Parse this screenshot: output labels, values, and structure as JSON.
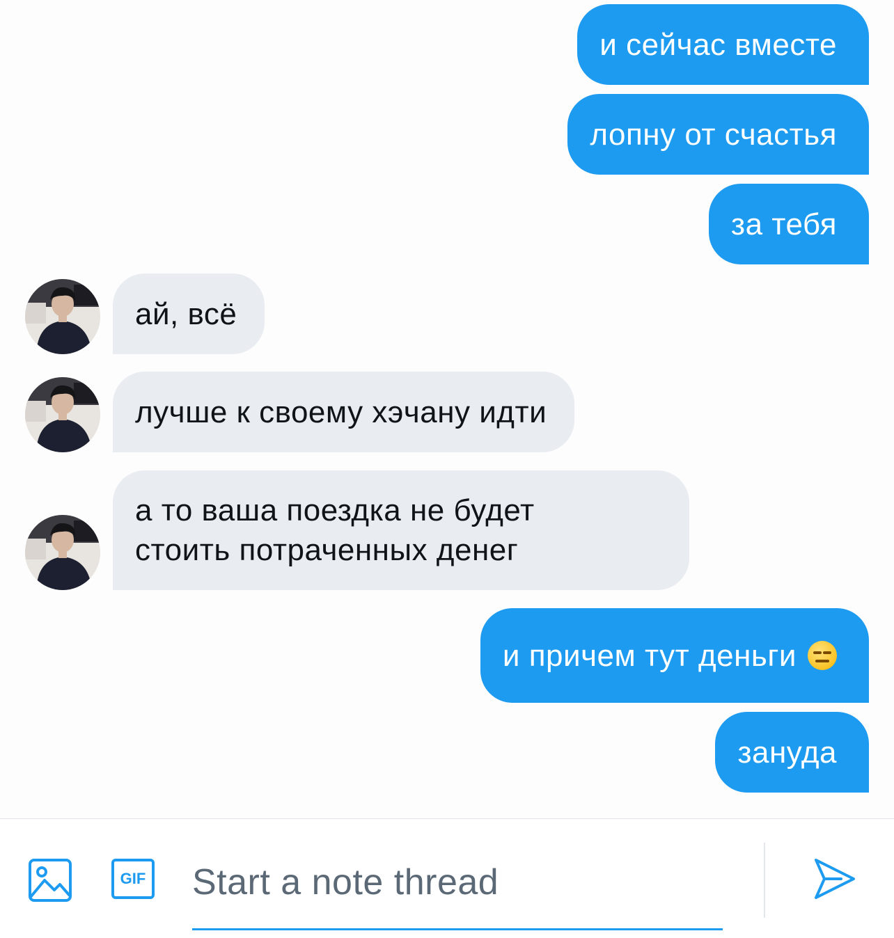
{
  "messages": [
    {
      "side": "out",
      "text": "и сейчас вместе"
    },
    {
      "side": "out",
      "text": "лопну от счастья"
    },
    {
      "side": "out",
      "text": "за тебя"
    },
    {
      "side": "in",
      "text": "ай, всё"
    },
    {
      "side": "in",
      "text": "лучше к своему хэчану идти"
    },
    {
      "side": "in",
      "lines": [
        "а то ваша поездка не будет",
        "стоить потраченных денег"
      ]
    },
    {
      "side": "out",
      "text": "и причем тут деньги",
      "emoji": "expressionless-face-emoji"
    },
    {
      "side": "out",
      "text": "зануда"
    }
  ],
  "composer": {
    "placeholder": "Start a note thread",
    "gif_label": "GIF",
    "image_icon": "image-icon",
    "send_icon": "send-icon"
  },
  "colors": {
    "accent": "#1d9bf0",
    "incoming_bubble": "#e9ecf1",
    "placeholder": "#5b6875"
  }
}
